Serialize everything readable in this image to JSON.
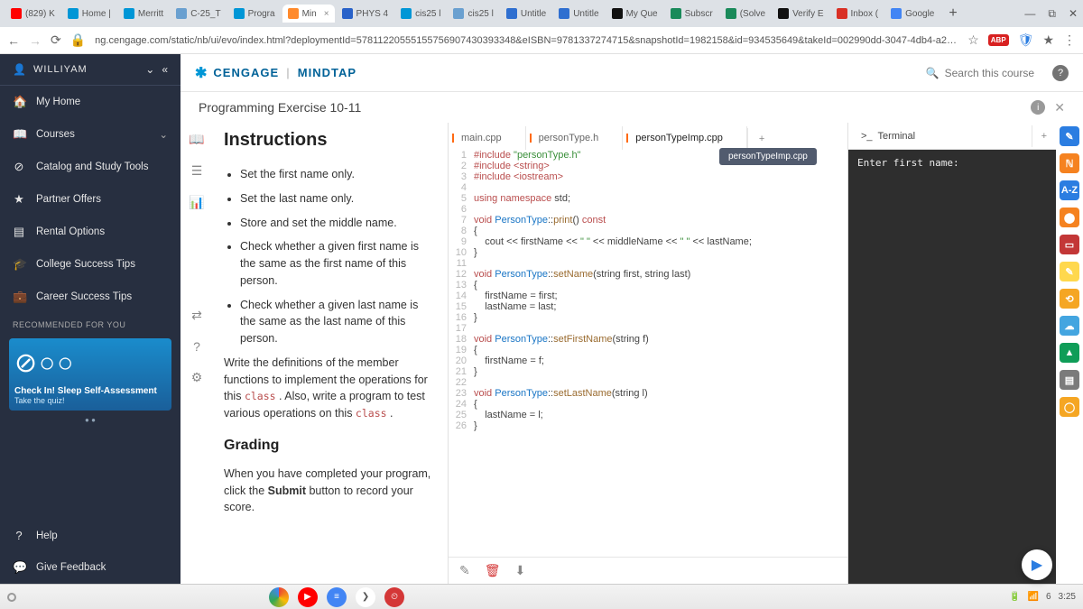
{
  "browser": {
    "tabs": [
      {
        "label": "(829) K",
        "color": "#ff0000"
      },
      {
        "label": "Home |",
        "color": "#0096d6"
      },
      {
        "label": "Merritt",
        "color": "#0096d6"
      },
      {
        "label": "C-25_T",
        "color": "#6aa0d0"
      },
      {
        "label": "Progra",
        "color": "#0096d6"
      },
      {
        "label": "Min",
        "color": "#ff8a2c"
      },
      {
        "label": "PHYS 4",
        "color": "#2962c9"
      },
      {
        "label": "cis25 l",
        "color": "#0096d6"
      },
      {
        "label": "cis25 l",
        "color": "#6aa0d0"
      },
      {
        "label": "Untitle",
        "color": "#2f6fd0"
      },
      {
        "label": "Untitle",
        "color": "#2f6fd0"
      },
      {
        "label": "My Que",
        "color": "#111"
      },
      {
        "label": "Subscr",
        "color": "#1a8a5a"
      },
      {
        "label": "(Solve",
        "color": "#1a8a5a"
      },
      {
        "label": "Verify E",
        "color": "#111"
      },
      {
        "label": "Inbox (",
        "color": "#d93025"
      },
      {
        "label": "Google",
        "color": "#4285f4"
      }
    ],
    "active_tab": 5,
    "url": "ng.cengage.com/static/nb/ui/evo/index.html?deploymentId=57811220555155756907430393348&eISBN=9781337274715&snapshotId=1982158&id=934535649&takeId=002990dd-3047-4db4-a2…"
  },
  "sidebar": {
    "user": "WILLIYAM",
    "items": [
      {
        "icon": "🏠",
        "label": "My Home"
      },
      {
        "icon": "📖",
        "label": "Courses"
      },
      {
        "icon": "⊘",
        "label": "Catalog and Study Tools"
      },
      {
        "icon": "★",
        "label": "Partner Offers"
      },
      {
        "icon": "▤",
        "label": "Rental Options"
      },
      {
        "icon": "🎓",
        "label": "College Success Tips"
      },
      {
        "icon": "💼",
        "label": "Career Success Tips"
      }
    ],
    "recommended": "RECOMMENDED FOR YOU",
    "promo_title": "Check In! Sleep Self-Assessment",
    "promo_sub": "Take the quiz!",
    "help": {
      "icon": "?",
      "label": "Help"
    },
    "feedback": {
      "icon": "💬",
      "label": "Give Feedback"
    }
  },
  "header": {
    "brand1": "CENGAGE",
    "brand2": "MINDTAP",
    "search": "Search this course",
    "title": "Programming Exercise 10-11"
  },
  "tools": [
    "📖",
    "☰",
    "📊",
    "</>",
    "",
    "",
    "",
    "",
    "⇄",
    "?",
    "⚙"
  ],
  "instructions": {
    "heading": "Instructions",
    "bullets": [
      "Set the first name only.",
      "Set the last name only.",
      "Store and set the middle name.",
      "Check whether a given first name is the same as the first name of this person.",
      "Check whether a given last name is the same as the last name of this person."
    ],
    "para": "Write the definitions of the member functions to implement the operations for this ",
    "para_code1": "class",
    "para2": " . Also, write a program to test various operations on this ",
    "para_code2": "class",
    "para3": " .",
    "grading": "Grading",
    "grading_body1": "When you have completed your program, click the ",
    "grading_bold": "Submit",
    "grading_body2": " button to record your score."
  },
  "files": {
    "tabs": [
      "main.cpp",
      "personType.h",
      "personTypeImp.cpp"
    ],
    "active": 2,
    "tooltip": "personTypeImp.cpp",
    "lines": [
      {
        "n": 1,
        "t": "#include",
        "arg": "\"personType.h\"",
        "cls": "inc"
      },
      {
        "n": 2,
        "t": "#include",
        "arg": "<string>",
        "cls": "inc"
      },
      {
        "n": 3,
        "t": "#include",
        "arg": "<iostream>",
        "cls": "inc"
      },
      {
        "n": 4,
        "raw": ""
      },
      {
        "n": 5,
        "raw": "<span class='kw'>using</span> <span class='kw'>namespace</span> std;"
      },
      {
        "n": 6,
        "raw": ""
      },
      {
        "n": 7,
        "raw": "<span class='kw'>void</span> <span class='type'>PersonType</span>::<span class='func'>print</span>() <span class='kw'>const</span>"
      },
      {
        "n": 8,
        "raw": "{"
      },
      {
        "n": 9,
        "raw": "    cout &lt;&lt; firstName &lt;&lt; <span class='str'>\" \"</span> &lt;&lt; middleName &lt;&lt; <span class='str'>\" \"</span> &lt;&lt; lastName;"
      },
      {
        "n": 10,
        "raw": "}"
      },
      {
        "n": 11,
        "raw": ""
      },
      {
        "n": 12,
        "raw": "<span class='kw'>void</span> <span class='type'>PersonType</span>::<span class='func'>setName</span>(string first, string last)"
      },
      {
        "n": 13,
        "raw": "{"
      },
      {
        "n": 14,
        "raw": "    firstName = first;"
      },
      {
        "n": 15,
        "raw": "    lastName = last;"
      },
      {
        "n": 16,
        "raw": "}"
      },
      {
        "n": 17,
        "raw": ""
      },
      {
        "n": 18,
        "raw": "<span class='kw'>void</span> <span class='type'>PersonType</span>::<span class='func'>setFirstName</span>(string f)"
      },
      {
        "n": 19,
        "raw": "{"
      },
      {
        "n": 20,
        "raw": "    firstName = f;"
      },
      {
        "n": 21,
        "raw": "}"
      },
      {
        "n": 22,
        "raw": ""
      },
      {
        "n": 23,
        "raw": "<span class='kw'>void</span> <span class='type'>PersonType</span>::<span class='func'>setLastName</span>(string l)"
      },
      {
        "n": 24,
        "raw": "{"
      },
      {
        "n": 25,
        "raw": "    lastName = l;"
      },
      {
        "n": 26,
        "raw": "}"
      }
    ]
  },
  "terminal": {
    "tab": "Terminal",
    "output": "Enter first name:"
  },
  "rightbar": [
    {
      "bg": "#2b7de1",
      "txt": "✎"
    },
    {
      "bg": "#f58220",
      "txt": "ℕ"
    },
    {
      "bg": "#2b7de1",
      "txt": "A-Z"
    },
    {
      "bg": "#f58220",
      "txt": "⬤"
    },
    {
      "bg": "#c33737",
      "txt": "▭"
    },
    {
      "bg": "#ffd84d",
      "txt": "✎"
    },
    {
      "bg": "#f5a623",
      "txt": "⟲"
    },
    {
      "bg": "#43a5e0",
      "txt": "☁"
    },
    {
      "bg": "#0f9d58",
      "txt": "▲"
    },
    {
      "bg": "#7b7b7b",
      "txt": "▤"
    },
    {
      "bg": "#f5a623",
      "txt": "◯"
    }
  ],
  "taskbar": {
    "battery": "6",
    "time": "3:25"
  }
}
